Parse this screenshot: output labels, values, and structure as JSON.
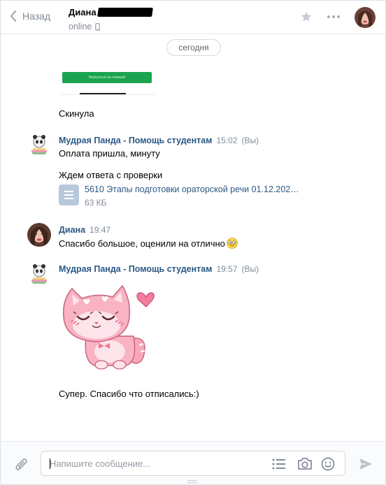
{
  "header": {
    "back_label": "Назад",
    "peer_name": "Диана",
    "peer_status": "online"
  },
  "date_separator": "сегодня",
  "attachment_button_text": "Вернуться на главный",
  "messages": [
    {
      "text": "Скинула"
    },
    {
      "author": "Мудрая Панда - Помощь студентам",
      "time": "15:02",
      "mark": "(Вы)",
      "lines": [
        "Оплата пришла, минуту",
        "Ждем ответа с проверки"
      ],
      "document": {
        "name": "5610 Этапы подготовки ораторской речи 01.12.202…",
        "size": "63 КБ"
      }
    },
    {
      "author": "Диана",
      "time": "19:47",
      "text": "Спасибо большое, оценили на отлично"
    },
    {
      "author": "Мудрая Панда - Помощь студентам",
      "time": "19:57",
      "mark": "(Вы)",
      "sticker": "pink-cat-sticker",
      "text": "Супер. Спасибо что отписались:)"
    }
  ],
  "composer": {
    "placeholder": "Напишите сообщение..."
  },
  "icons": [
    "chevron-left-icon",
    "phone-icon",
    "star-icon",
    "more-icon",
    "paperclip-icon",
    "list-icon",
    "camera-icon",
    "smile-icon",
    "send-icon",
    "document-icon",
    "emoji-icon"
  ],
  "colors": {
    "link": "#2a5885",
    "secondary": "#828a99",
    "green_button": "#1aa450",
    "sticker_pink": "#f7a6b5"
  }
}
